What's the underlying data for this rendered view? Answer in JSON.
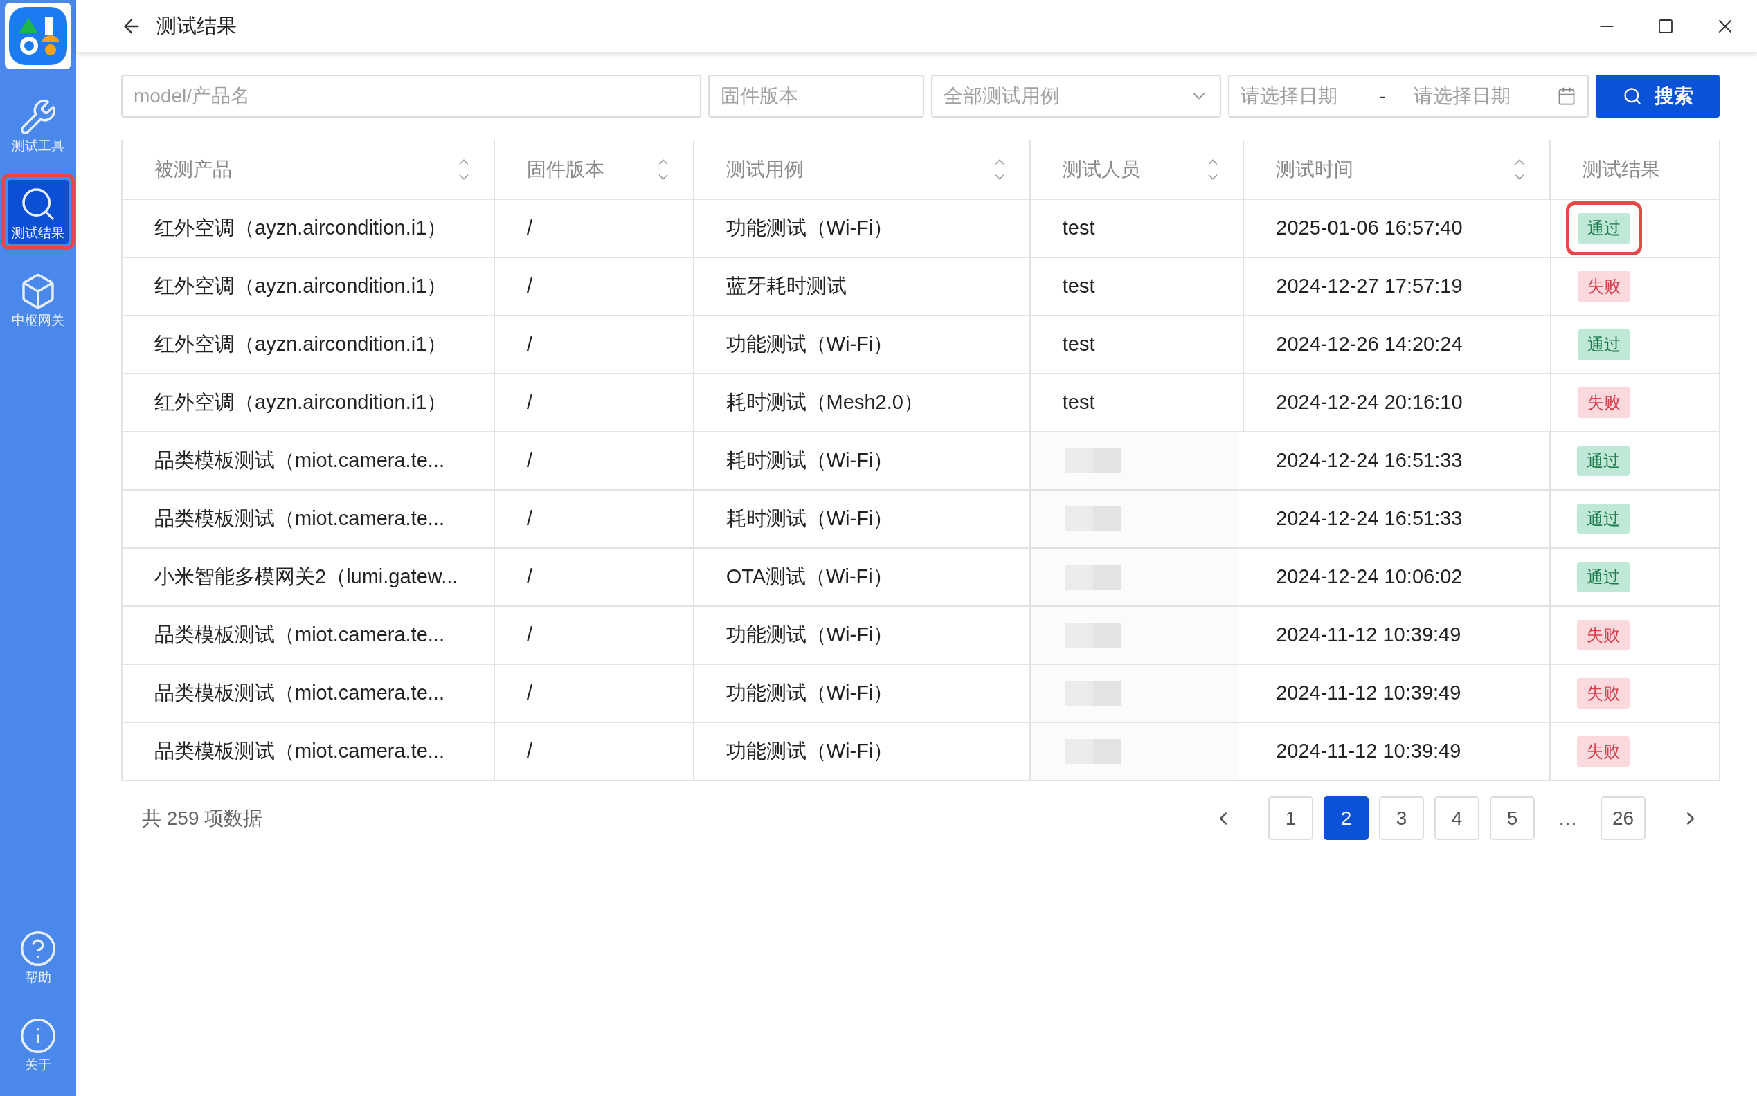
{
  "sidebar": {
    "items": [
      {
        "label": "测试工具",
        "selected": false,
        "highlighted": false
      },
      {
        "label": "测试结果",
        "selected": true,
        "highlighted": true
      },
      {
        "label": "中枢网关",
        "selected": false,
        "highlighted": false
      }
    ],
    "bottom_items": [
      {
        "label": "帮助"
      },
      {
        "label": "关于"
      }
    ]
  },
  "window": {
    "title": "测试结果"
  },
  "filters": {
    "model": {
      "placeholder": "model/产品名"
    },
    "firmware": {
      "placeholder": "固件版本"
    },
    "test_case": {
      "placeholder": "全部测试用例"
    },
    "date_start": {
      "placeholder": "请选择日期"
    },
    "date_separator": "-",
    "date_end": {
      "placeholder": "请选择日期"
    },
    "search_button": "搜索"
  },
  "table": {
    "columns": [
      {
        "label": "被测产品",
        "sortable": true
      },
      {
        "label": "固件版本",
        "sortable": true
      },
      {
        "label": "测试用例",
        "sortable": true
      },
      {
        "label": "测试人员",
        "sortable": true
      },
      {
        "label": "测试时间",
        "sortable": true
      },
      {
        "label": "测试结果",
        "sortable": false
      }
    ],
    "rows": [
      {
        "product": "红外空调（ayzn.aircondition.i1）",
        "firmware": "/",
        "case": "功能测试（Wi-Fi）",
        "tester": "test",
        "time": "2025-01-06 16:57:40",
        "result": {
          "label": "通过",
          "kind": "pass",
          "highlighted": true
        }
      },
      {
        "product": "红外空调（ayzn.aircondition.i1）",
        "firmware": "/",
        "case": "蓝牙耗时测试",
        "tester": "test",
        "time": "2024-12-27 17:57:19",
        "result": {
          "label": "失败",
          "kind": "fail",
          "highlighted": false
        }
      },
      {
        "product": "红外空调（ayzn.aircondition.i1）",
        "firmware": "/",
        "case": "功能测试（Wi-Fi）",
        "tester": "test",
        "time": "2024-12-26 14:20:24",
        "result": {
          "label": "通过",
          "kind": "pass",
          "highlighted": false
        }
      },
      {
        "product": "红外空调（ayzn.aircondition.i1）",
        "firmware": "/",
        "case": "耗时测试（Mesh2.0）",
        "tester": "test",
        "time": "2024-12-24 20:16:10",
        "result": {
          "label": "失败",
          "kind": "fail",
          "highlighted": false
        }
      },
      {
        "product": "品类模板测试（miot.camera.te...",
        "firmware": "/",
        "case": "耗时测试（Wi-Fi）",
        "time": "2024-12-24 16:51:33",
        "result": {
          "label": "通过",
          "kind": "pass",
          "highlighted": false
        }
      },
      {
        "product": "品类模板测试（miot.camera.te...",
        "firmware": "/",
        "case": "耗时测试（Wi-Fi）",
        "time": "2024-12-24 16:51:33",
        "result": {
          "label": "通过",
          "kind": "pass",
          "highlighted": false
        }
      },
      {
        "product": "小米智能多模网关2（lumi.gatew...",
        "firmware": "/",
        "case": "OTA测试（Wi-Fi）",
        "time": "2024-12-24 10:06:02",
        "result": {
          "label": "通过",
          "kind": "pass",
          "highlighted": false
        }
      },
      {
        "product": "品类模板测试（miot.camera.te...",
        "firmware": "/",
        "case": "功能测试（Wi-Fi）",
        "time": "2024-11-12 10:39:49",
        "result": {
          "label": "失败",
          "kind": "fail",
          "highlighted": false
        }
      },
      {
        "product": "品类模板测试（miot.camera.te...",
        "firmware": "/",
        "case": "功能测试（Wi-Fi）",
        "time": "2024-11-12 10:39:49",
        "result": {
          "label": "失败",
          "kind": "fail",
          "highlighted": false
        }
      },
      {
        "product": "品类模板测试（miot.camera.te...",
        "firmware": "/",
        "case": "功能测试（Wi-Fi）",
        "time": "2024-11-12 10:39:49",
        "result": {
          "label": "失败",
          "kind": "fail",
          "highlighted": false
        }
      }
    ]
  },
  "pagination": {
    "total": "共 259 项数据",
    "pages": [
      {
        "label": "1",
        "selected": false
      },
      {
        "label": "2",
        "selected": true
      },
      {
        "label": "3",
        "selected": false
      },
      {
        "label": "4",
        "selected": false
      },
      {
        "label": "5",
        "selected": false
      },
      {
        "label": "…",
        "kind": "ellipsis"
      },
      {
        "label": "26",
        "selected": false
      }
    ]
  }
}
